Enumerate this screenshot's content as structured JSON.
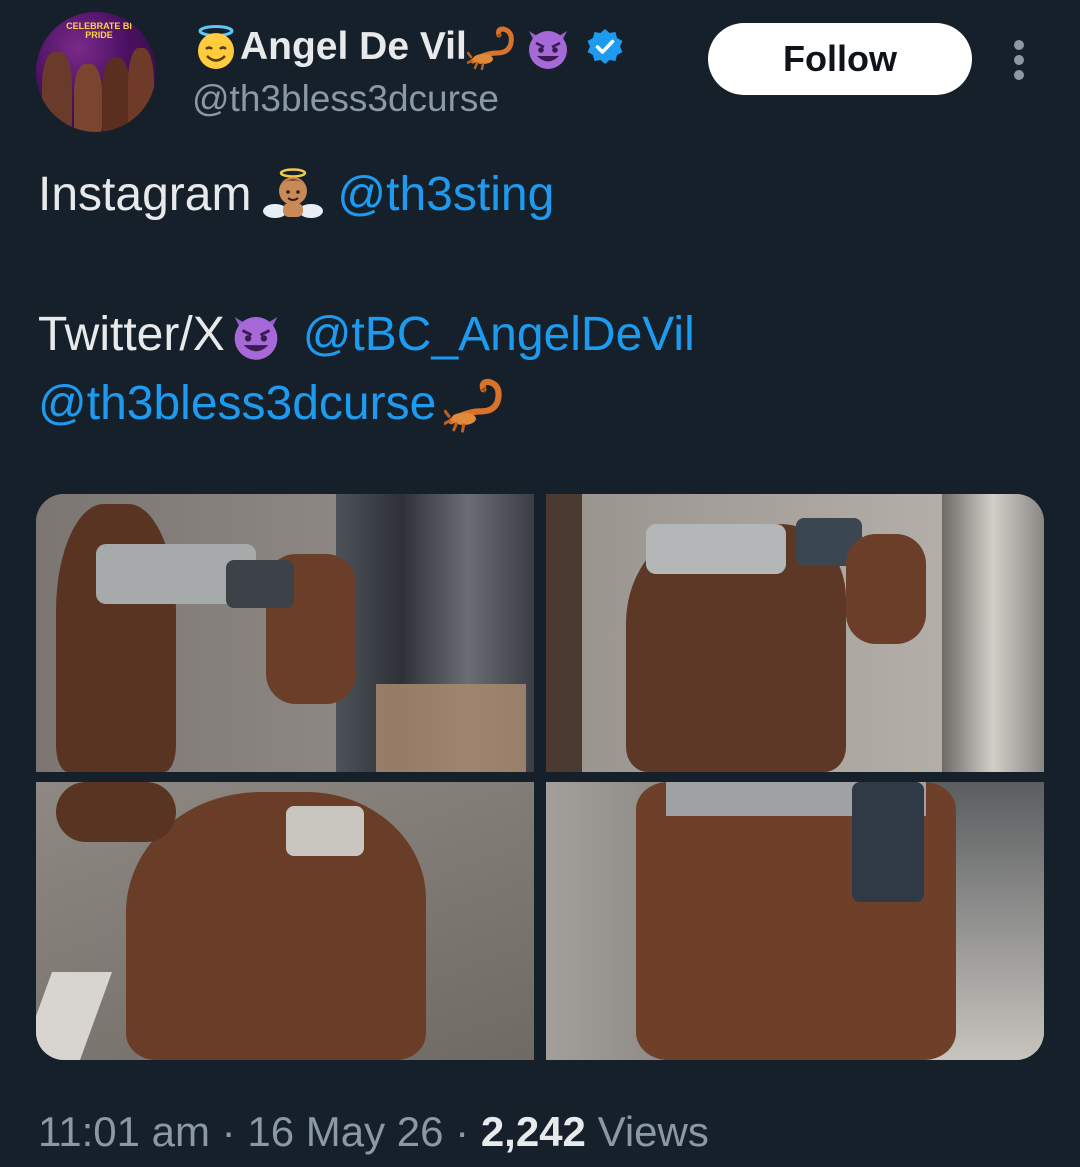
{
  "profile": {
    "display_name": "Angel De Vil",
    "name_prefix_emoji": "smiling-face-with-halo",
    "name_suffix_emojis": [
      "scorpion",
      "smiling-face-with-horns"
    ],
    "verified": true,
    "handle": "@th3bless3dcurse",
    "avatar_text": "CELEBRATE BI PRIDE",
    "follow_label": "Follow",
    "more_icon": "more-vertical-icon"
  },
  "tweet": {
    "lines": [
      {
        "label": "Instagram",
        "emoji": "baby-angel",
        "mention": "@th3sting"
      },
      {
        "label": "Twitter/X",
        "emoji": "smiling-face-with-horns",
        "mention": "@tBC_AngelDeVil"
      },
      {
        "mention": "@th3bless3dcurse",
        "emoji": "scorpion"
      }
    ]
  },
  "media": {
    "count": 4,
    "photos": [
      "photo 1",
      "photo 2",
      "photo 3",
      "photo 4"
    ]
  },
  "meta": {
    "time": "11:01 am",
    "separator": "·",
    "date": "16 May 26",
    "views_count": "2,242",
    "views_label": "Views"
  },
  "colors": {
    "background": "#15202b",
    "text": "#e7e9ea",
    "secondary_text": "#8b98a5",
    "link": "#1d9bf0",
    "verified_badge": "#1d9bf0",
    "follow_button_bg": "#ffffff",
    "follow_button_text": "#0f1419"
  }
}
